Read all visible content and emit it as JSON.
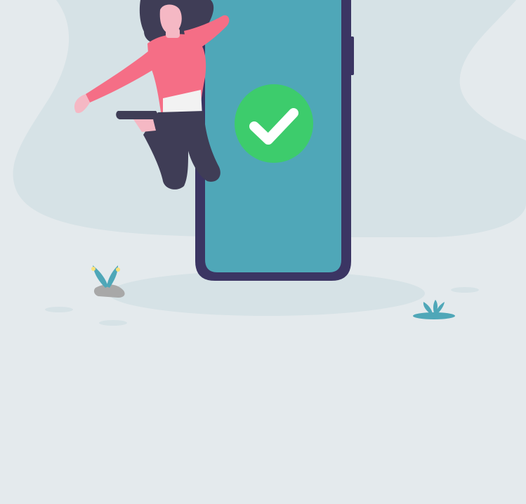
{
  "illustration": {
    "subject": "success-confirmation",
    "icon": "checkmark-icon",
    "colors": {
      "background": "#e4eaed",
      "blob": "#d6e2e6",
      "phone_frame": "#3b3563",
      "phone_screen": "#4fa7b8",
      "check_circle": "#3dcc6c",
      "shirt": "#f56e86",
      "pants": "#3f3d56",
      "skin": "#f5b8c4",
      "plant": "#4fa7b8",
      "rock": "#a8a8a8"
    }
  }
}
